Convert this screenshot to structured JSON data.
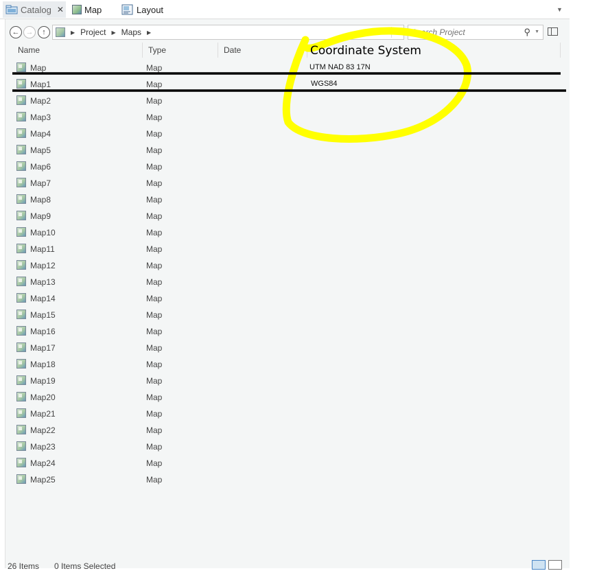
{
  "tabs": [
    {
      "label": "Catalog",
      "icon": "catalog-icon",
      "active": true
    },
    {
      "label": "Map",
      "icon": "map-icon",
      "active": false
    },
    {
      "label": "Layout",
      "icon": "layout-icon",
      "active": false
    }
  ],
  "nav": {
    "back_icon": "back-arrow-icon",
    "forward_icon": "forward-arrow-icon",
    "up_icon": "up-arrow-icon"
  },
  "path": {
    "segments": [
      "Project",
      "Maps"
    ],
    "refresh_icon": "refresh-icon"
  },
  "search": {
    "placeholder": "Search Project",
    "value": ""
  },
  "columns": {
    "name": "Name",
    "type": "Type",
    "date": "Date"
  },
  "annotation": {
    "heading": "Coordinate System",
    "highlight_color": "#ffff00",
    "line_color": "#000000"
  },
  "items": [
    {
      "name": "Map",
      "type": "Map",
      "coordinate_system": "UTM NAD 83 17N"
    },
    {
      "name": "Map1",
      "type": "Map",
      "coordinate_system": "WGS84"
    },
    {
      "name": "Map2",
      "type": "Map"
    },
    {
      "name": "Map3",
      "type": "Map"
    },
    {
      "name": "Map4",
      "type": "Map"
    },
    {
      "name": "Map5",
      "type": "Map"
    },
    {
      "name": "Map6",
      "type": "Map"
    },
    {
      "name": "Map7",
      "type": "Map"
    },
    {
      "name": "Map8",
      "type": "Map"
    },
    {
      "name": "Map9",
      "type": "Map"
    },
    {
      "name": "Map10",
      "type": "Map"
    },
    {
      "name": "Map11",
      "type": "Map"
    },
    {
      "name": "Map12",
      "type": "Map"
    },
    {
      "name": "Map13",
      "type": "Map"
    },
    {
      "name": "Map14",
      "type": "Map"
    },
    {
      "name": "Map15",
      "type": "Map"
    },
    {
      "name": "Map16",
      "type": "Map"
    },
    {
      "name": "Map17",
      "type": "Map"
    },
    {
      "name": "Map18",
      "type": "Map"
    },
    {
      "name": "Map19",
      "type": "Map"
    },
    {
      "name": "Map20",
      "type": "Map"
    },
    {
      "name": "Map21",
      "type": "Map"
    },
    {
      "name": "Map22",
      "type": "Map"
    },
    {
      "name": "Map23",
      "type": "Map"
    },
    {
      "name": "Map24",
      "type": "Map"
    },
    {
      "name": "Map25",
      "type": "Map"
    }
  ],
  "status": {
    "items_count": "26 Items",
    "selected_count": "0 Items Selected"
  }
}
